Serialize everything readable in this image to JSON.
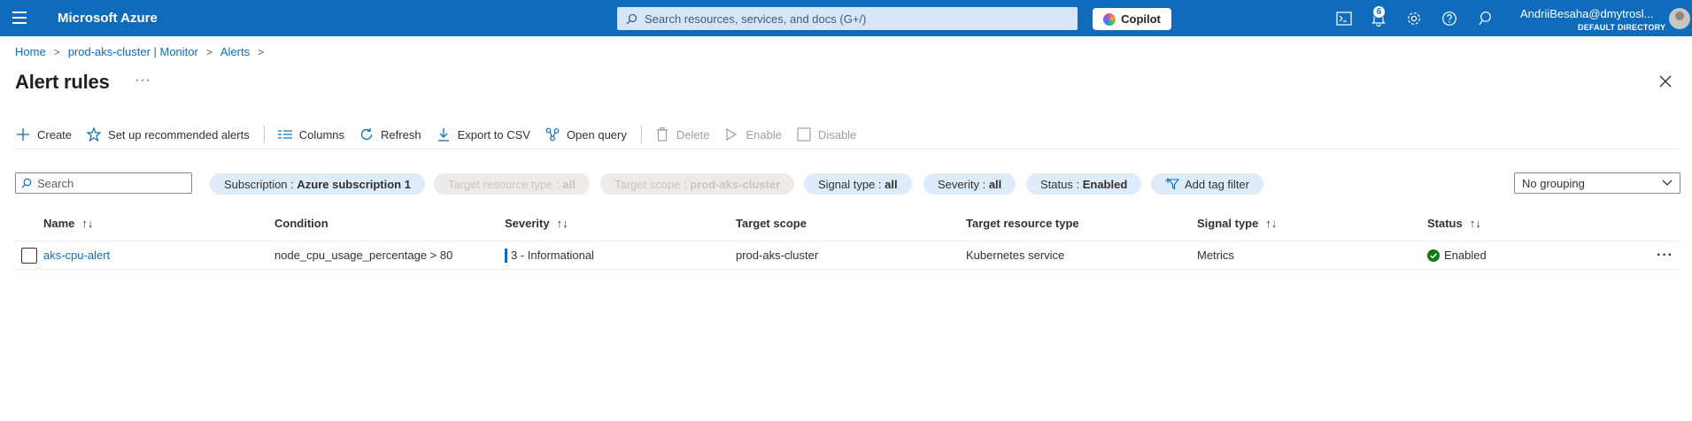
{
  "topbar": {
    "brand": "Microsoft Azure",
    "search_placeholder": "Search resources, services, and docs (G+/)",
    "copilot_label": "Copilot",
    "notification_count": "6",
    "user_name": "AndriiBesaha@dmytrosl...",
    "user_directory": "DEFAULT DIRECTORY"
  },
  "breadcrumb": [
    "Home",
    "prod-aks-cluster | Monitor",
    "Alerts"
  ],
  "page": {
    "title": "Alert rules",
    "more": "···"
  },
  "toolbar": {
    "create": "Create",
    "recommended": "Set up recommended alerts",
    "columns": "Columns",
    "refresh": "Refresh",
    "export": "Export to CSV",
    "open_query": "Open query",
    "delete": "Delete",
    "enable": "Enable",
    "disable": "Disable"
  },
  "filters": {
    "search_placeholder": "Search",
    "subscription": {
      "label": "Subscription : ",
      "value": "Azure subscription 1"
    },
    "target_resource_type": {
      "label": "Target resource type : ",
      "value": "all"
    },
    "target_scope": {
      "label": "Target scope : ",
      "value": "prod-aks-cluster"
    },
    "signal_type": {
      "label": "Signal type : ",
      "value": "all"
    },
    "severity": {
      "label": "Severity : ",
      "value": "all"
    },
    "status": {
      "label": "Status : ",
      "value": "Enabled"
    },
    "add_tag": "Add tag filter",
    "grouping": "No grouping"
  },
  "table": {
    "columns": [
      "Name",
      "Condition",
      "Severity",
      "Target scope",
      "Target resource type",
      "Signal type",
      "Status"
    ],
    "sort_glyph": "↑↓",
    "rows": [
      {
        "name": "aks-cpu-alert",
        "condition": "node_cpu_usage_percentage > 80",
        "severity": "3 - Informational",
        "target_scope": "prod-aks-cluster",
        "target_resource_type": "Kubernetes service",
        "signal_type": "Metrics",
        "status": "Enabled"
      }
    ]
  },
  "colors": {
    "brand_blue": "#0f6cbd",
    "status_green": "#107c10"
  }
}
